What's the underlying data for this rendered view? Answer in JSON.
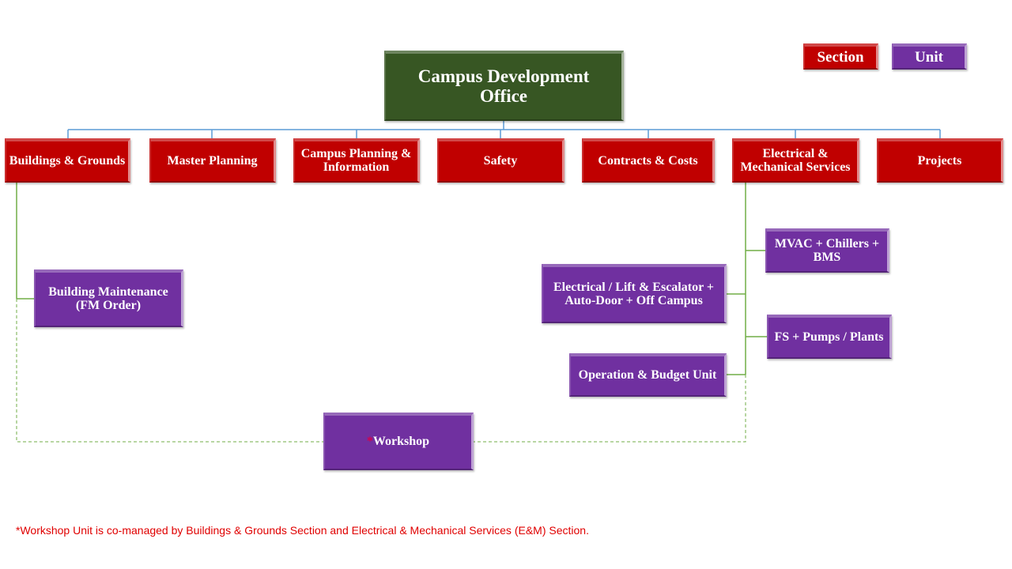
{
  "colors": {
    "root": "#375623",
    "section": "#c00000",
    "unit": "#7030a0",
    "top_connector": "#5b9bd5",
    "unit_connector": "#70ad47",
    "footnote": "#e00000"
  },
  "legend": {
    "section_label": "Section",
    "unit_label": "Unit"
  },
  "root": {
    "title": "Campus Development\nOffice"
  },
  "sections": [
    {
      "label": "Buildings & Grounds"
    },
    {
      "label": "Master Planning"
    },
    {
      "label": "Campus Planning &\nInformation"
    },
    {
      "label": "Safety"
    },
    {
      "label": "Contracts & Costs"
    },
    {
      "label": "Electrical &\nMechanical Services"
    },
    {
      "label": "Projects"
    }
  ],
  "units": {
    "building_maintenance": {
      "label": "Building Maintenance\n(FM Order)",
      "parent": "Buildings & Grounds"
    },
    "mvac": {
      "label": "MVAC + Chillers +\nBMS",
      "parent": "Electrical & Mechanical Services"
    },
    "electrical_lift": {
      "label": "Electrical / Lift & Escalator +\nAuto-Door + Off Campus",
      "parent": "Electrical & Mechanical Services"
    },
    "fs_pumps": {
      "label": "FS + Pumps / Plants",
      "parent": "Electrical & Mechanical Services"
    },
    "operation_budget": {
      "label": "Operation & Budget Unit",
      "parent": "Electrical & Mechanical Services"
    },
    "workshop": {
      "marker": "*",
      "label": "Workshop",
      "parent": "Buildings & Grounds; Electrical & Mechanical Services (co-managed)"
    }
  },
  "footnote": "*Workshop  Unit is co-managed by Buildings & Grounds Section and Electrical & Mechanical Services (E&M) Section."
}
